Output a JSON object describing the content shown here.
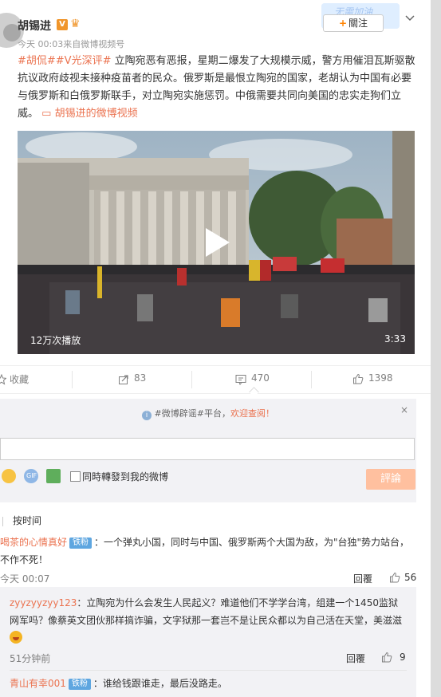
{
  "post": {
    "author": "胡锡进",
    "meta": "今天 00:03来自微博视频号",
    "tags": "#胡侃##V光深评#",
    "text": " 立陶宛恶有恶报，星期二爆发了大规模示威，警方用催泪瓦斯驱散抗议政府歧视未接种疫苗者的民众。俄罗斯是最恨立陶宛的国家，老胡认为中国有必要与俄罗斯和白俄罗斯联手，对立陶宛实施惩罚。中俄需要共同向美国的忠实走狗们立威。",
    "video_link": "胡锡进的微博视频",
    "follow_label": "關注",
    "follow_deco_text": "无需加油"
  },
  "video": {
    "views": "12万次播放",
    "duration": "3:33"
  },
  "actions": {
    "favorite": "收藏",
    "repost": "83",
    "comment": "470",
    "like": "1398"
  },
  "comment_box": {
    "notice_prefix": "#微博辟谣#平台，",
    "notice_link": "欢迎查阅！",
    "close": "×",
    "repost_label": "同時轉發到我的微博",
    "submit": "評論"
  },
  "sort": {
    "label": "按时间"
  },
  "comments": [
    {
      "user": "喝茶的心情真好",
      "badge": "铁粉",
      "text": "：一个弹丸小国，同时与中国、俄罗斯两个大国为敌，为\"台独\"势力站台，不作不死！",
      "time": "今天 00:07",
      "reply": "回覆",
      "likes": "56"
    }
  ],
  "replies": [
    {
      "user": "zyyzyyzyy123",
      "text": "：立陶宛为什么会发生人民起义？难道他们不学学台湾，组建一个1450监狱网军吗？像蔡英文团伙那样搞诈骗，文字狱那一套岂不是让民众都以为自己活在天堂，美滋滋",
      "time": "51分钟前",
      "reply": "回覆",
      "likes": "9"
    },
    {
      "user": "青山有幸001",
      "badge": "铁粉",
      "text": "：谁给钱跟谁走，最后没路走。"
    }
  ],
  "colors": {
    "accent": "#eb7350",
    "orange": "#ff8200",
    "fan_badge": "#5ea6e0",
    "submit_disabled": "#ffc09f"
  }
}
